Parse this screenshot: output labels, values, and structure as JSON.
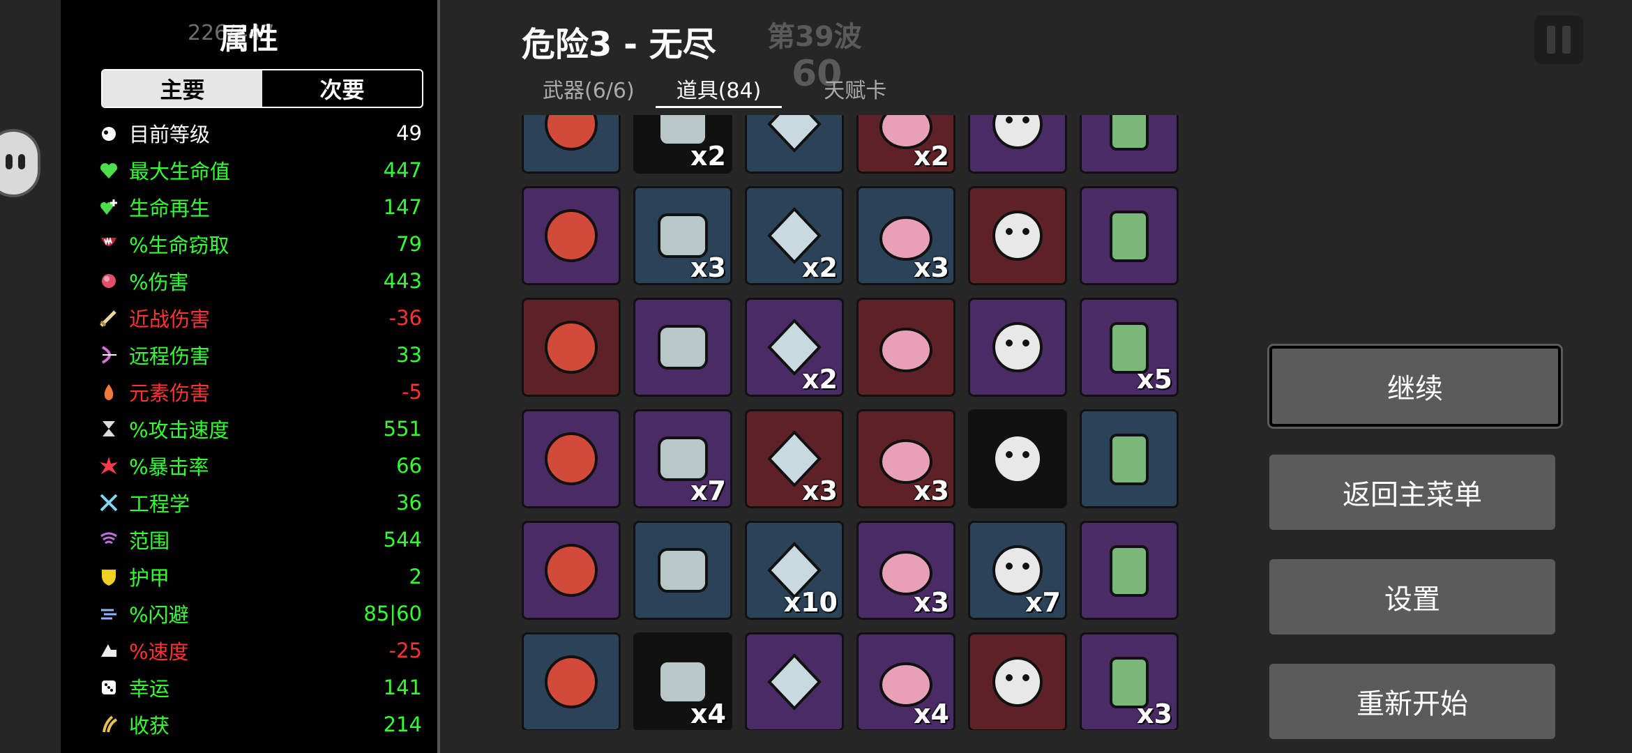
{
  "hud": {
    "hp_text": "226/447"
  },
  "stats": {
    "title": "属性",
    "tabs": [
      "主要",
      "次要"
    ],
    "rows": [
      {
        "label": "目前等级",
        "value": "49",
        "color": "#ffffff",
        "icon": "level-icon"
      },
      {
        "label": "最大生命值",
        "value": "447",
        "color": "#33ff33",
        "icon": "heart-icon"
      },
      {
        "label": "生命再生",
        "value": "147",
        "color": "#33ff33",
        "icon": "regen-icon"
      },
      {
        "label": "%生命窃取",
        "value": "79",
        "color": "#33ff33",
        "icon": "lifesteal-icon"
      },
      {
        "label": "%伤害",
        "value": "443",
        "color": "#33ff33",
        "icon": "damage-icon"
      },
      {
        "label": "近战伤害",
        "value": "-36",
        "color": "#ff3333",
        "icon": "melee-icon"
      },
      {
        "label": "远程伤害",
        "value": "33",
        "color": "#33ff33",
        "icon": "ranged-icon"
      },
      {
        "label": "元素伤害",
        "value": "-5",
        "color": "#ff3333",
        "icon": "elemental-icon"
      },
      {
        "label": "%攻击速度",
        "value": "551",
        "color": "#33ff33",
        "icon": "attack-speed-icon"
      },
      {
        "label": "%暴击率",
        "value": "66",
        "color": "#33ff33",
        "icon": "crit-icon"
      },
      {
        "label": "工程学",
        "value": "36",
        "color": "#33ff33",
        "icon": "engineering-icon"
      },
      {
        "label": "范围",
        "value": "544",
        "color": "#33ff33",
        "icon": "range-icon"
      },
      {
        "label": "护甲",
        "value": "2",
        "color": "#33ff33",
        "icon": "armor-icon"
      },
      {
        "label": "%闪避",
        "value": "85|60",
        "color": "#33ff33",
        "icon": "dodge-icon"
      },
      {
        "label": "%速度",
        "value": "-25",
        "color": "#ff3333",
        "icon": "speed-icon"
      },
      {
        "label": "幸运",
        "value": "141",
        "color": "#33ff33",
        "icon": "luck-icon"
      },
      {
        "label": "收获",
        "value": "214",
        "color": "#33ff33",
        "icon": "harvest-icon"
      }
    ]
  },
  "header": {
    "title": "危险3 - 无尽",
    "wave": "第39波",
    "timer": "60",
    "tabs": [
      "武器(6/6)",
      "道具(84)",
      "天赋卡"
    ]
  },
  "items": [
    {
      "name": "axe-item",
      "bg": "blue",
      "count": ""
    },
    {
      "name": "root-item",
      "bg": "black",
      "count": "x2"
    },
    {
      "name": "horn-item",
      "bg": "blue",
      "count": ""
    },
    {
      "name": "scroll-item",
      "bg": "red",
      "count": "x2"
    },
    {
      "name": "peacock-item",
      "bg": "purple",
      "count": ""
    },
    {
      "name": "turret-item",
      "bg": "purple",
      "count": ""
    },
    {
      "name": "tomato-item",
      "bg": "purple",
      "count": ""
    },
    {
      "name": "banner-item",
      "bg": "blue",
      "count": "x3"
    },
    {
      "name": "pendant-item",
      "bg": "blue",
      "count": "x2"
    },
    {
      "name": "medic-turret-item",
      "bg": "blue",
      "count": "x3"
    },
    {
      "name": "bloody-hand-item",
      "bg": "red",
      "count": ""
    },
    {
      "name": "crystal-item",
      "bg": "purple",
      "count": ""
    },
    {
      "name": "coin-item",
      "bg": "red",
      "count": ""
    },
    {
      "name": "chameleon-item",
      "bg": "purple",
      "count": ""
    },
    {
      "name": "bullet-item",
      "bg": "purple",
      "count": "x2"
    },
    {
      "name": "binoculars-item",
      "bg": "red",
      "count": ""
    },
    {
      "name": "beard-item",
      "bg": "purple",
      "count": ""
    },
    {
      "name": "blood-bag-item",
      "bg": "purple",
      "count": "x5"
    },
    {
      "name": "generator-item",
      "bg": "purple",
      "count": ""
    },
    {
      "name": "tractor-item",
      "bg": "purple",
      "count": "x7"
    },
    {
      "name": "rainbow-leaf-item",
      "bg": "red",
      "count": "x3"
    },
    {
      "name": "alien-turret-item",
      "bg": "red",
      "count": "x3"
    },
    {
      "name": "rubber-duck-item",
      "bg": "black",
      "count": ""
    },
    {
      "name": "machine-item",
      "bg": "blue",
      "count": ""
    },
    {
      "name": "wizard-item",
      "bg": "purple",
      "count": ""
    },
    {
      "name": "piggy-bank-item",
      "bg": "blue",
      "count": ""
    },
    {
      "name": "wheelbarrow-item",
      "bg": "blue",
      "count": "x10"
    },
    {
      "name": "wings-item",
      "bg": "purple",
      "count": "x3"
    },
    {
      "name": "frog-item",
      "bg": "blue",
      "count": "x7"
    },
    {
      "name": "brain-item",
      "bg": "purple",
      "count": ""
    },
    {
      "name": "factory-item",
      "bg": "blue",
      "count": ""
    },
    {
      "name": "dynamite-item",
      "bg": "black",
      "count": "x4"
    },
    {
      "name": "helmet-item",
      "bg": "purple",
      "count": ""
    },
    {
      "name": "statue-item",
      "bg": "purple",
      "count": "x4"
    },
    {
      "name": "stomach-item",
      "bg": "red",
      "count": ""
    },
    {
      "name": "tardigrade-item",
      "bg": "purple",
      "count": "x3"
    }
  ],
  "menu": {
    "continue": "继续",
    "main_menu": "返回主菜单",
    "settings": "设置",
    "restart": "重新开始"
  }
}
